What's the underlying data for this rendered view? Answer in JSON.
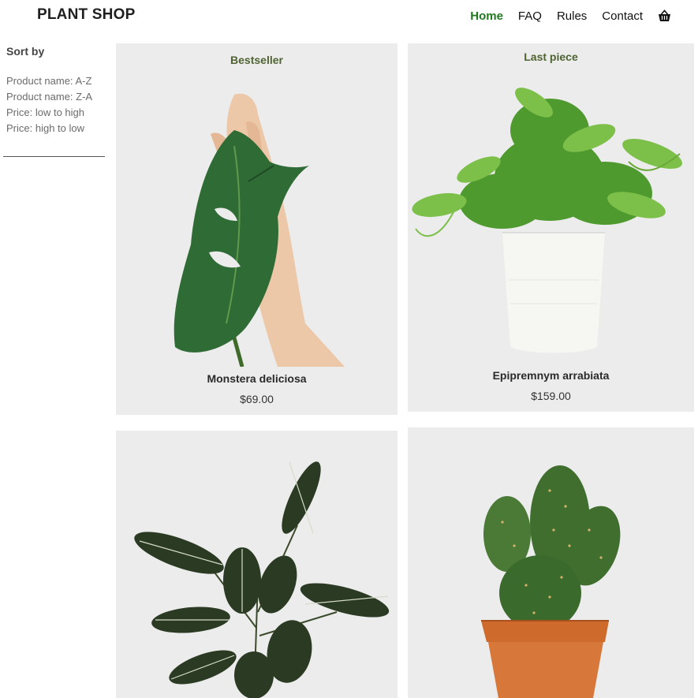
{
  "header": {
    "logo": "PLANT SHOP",
    "nav": [
      {
        "label": "Home",
        "active": true
      },
      {
        "label": "FAQ",
        "active": false
      },
      {
        "label": "Rules",
        "active": false
      },
      {
        "label": "Contact",
        "active": false
      }
    ],
    "cart_icon": "basket-icon"
  },
  "sidebar": {
    "title": "Sort by",
    "options": [
      "Product name: A-Z",
      "Product name: Z-A",
      "Price: low to high",
      "Price: high to low"
    ]
  },
  "products": [
    {
      "badge": "Bestseller",
      "name": "Monstera deliciosa",
      "price": "$69.00",
      "image": "monstera-leaf-in-hand"
    },
    {
      "badge": "Last piece",
      "name": "Epipremnym arrabiata",
      "price": "$159.00",
      "image": "pothos-in-white-pot"
    },
    {
      "badge": "",
      "name": "",
      "price": "",
      "image": "calathea-plant"
    },
    {
      "badge": "",
      "name": "",
      "price": "",
      "image": "cactus-in-terracotta-pot"
    }
  ],
  "colors": {
    "accent": "#1f7a1f",
    "card_background": "#ececec",
    "badge": "#4f6331"
  }
}
